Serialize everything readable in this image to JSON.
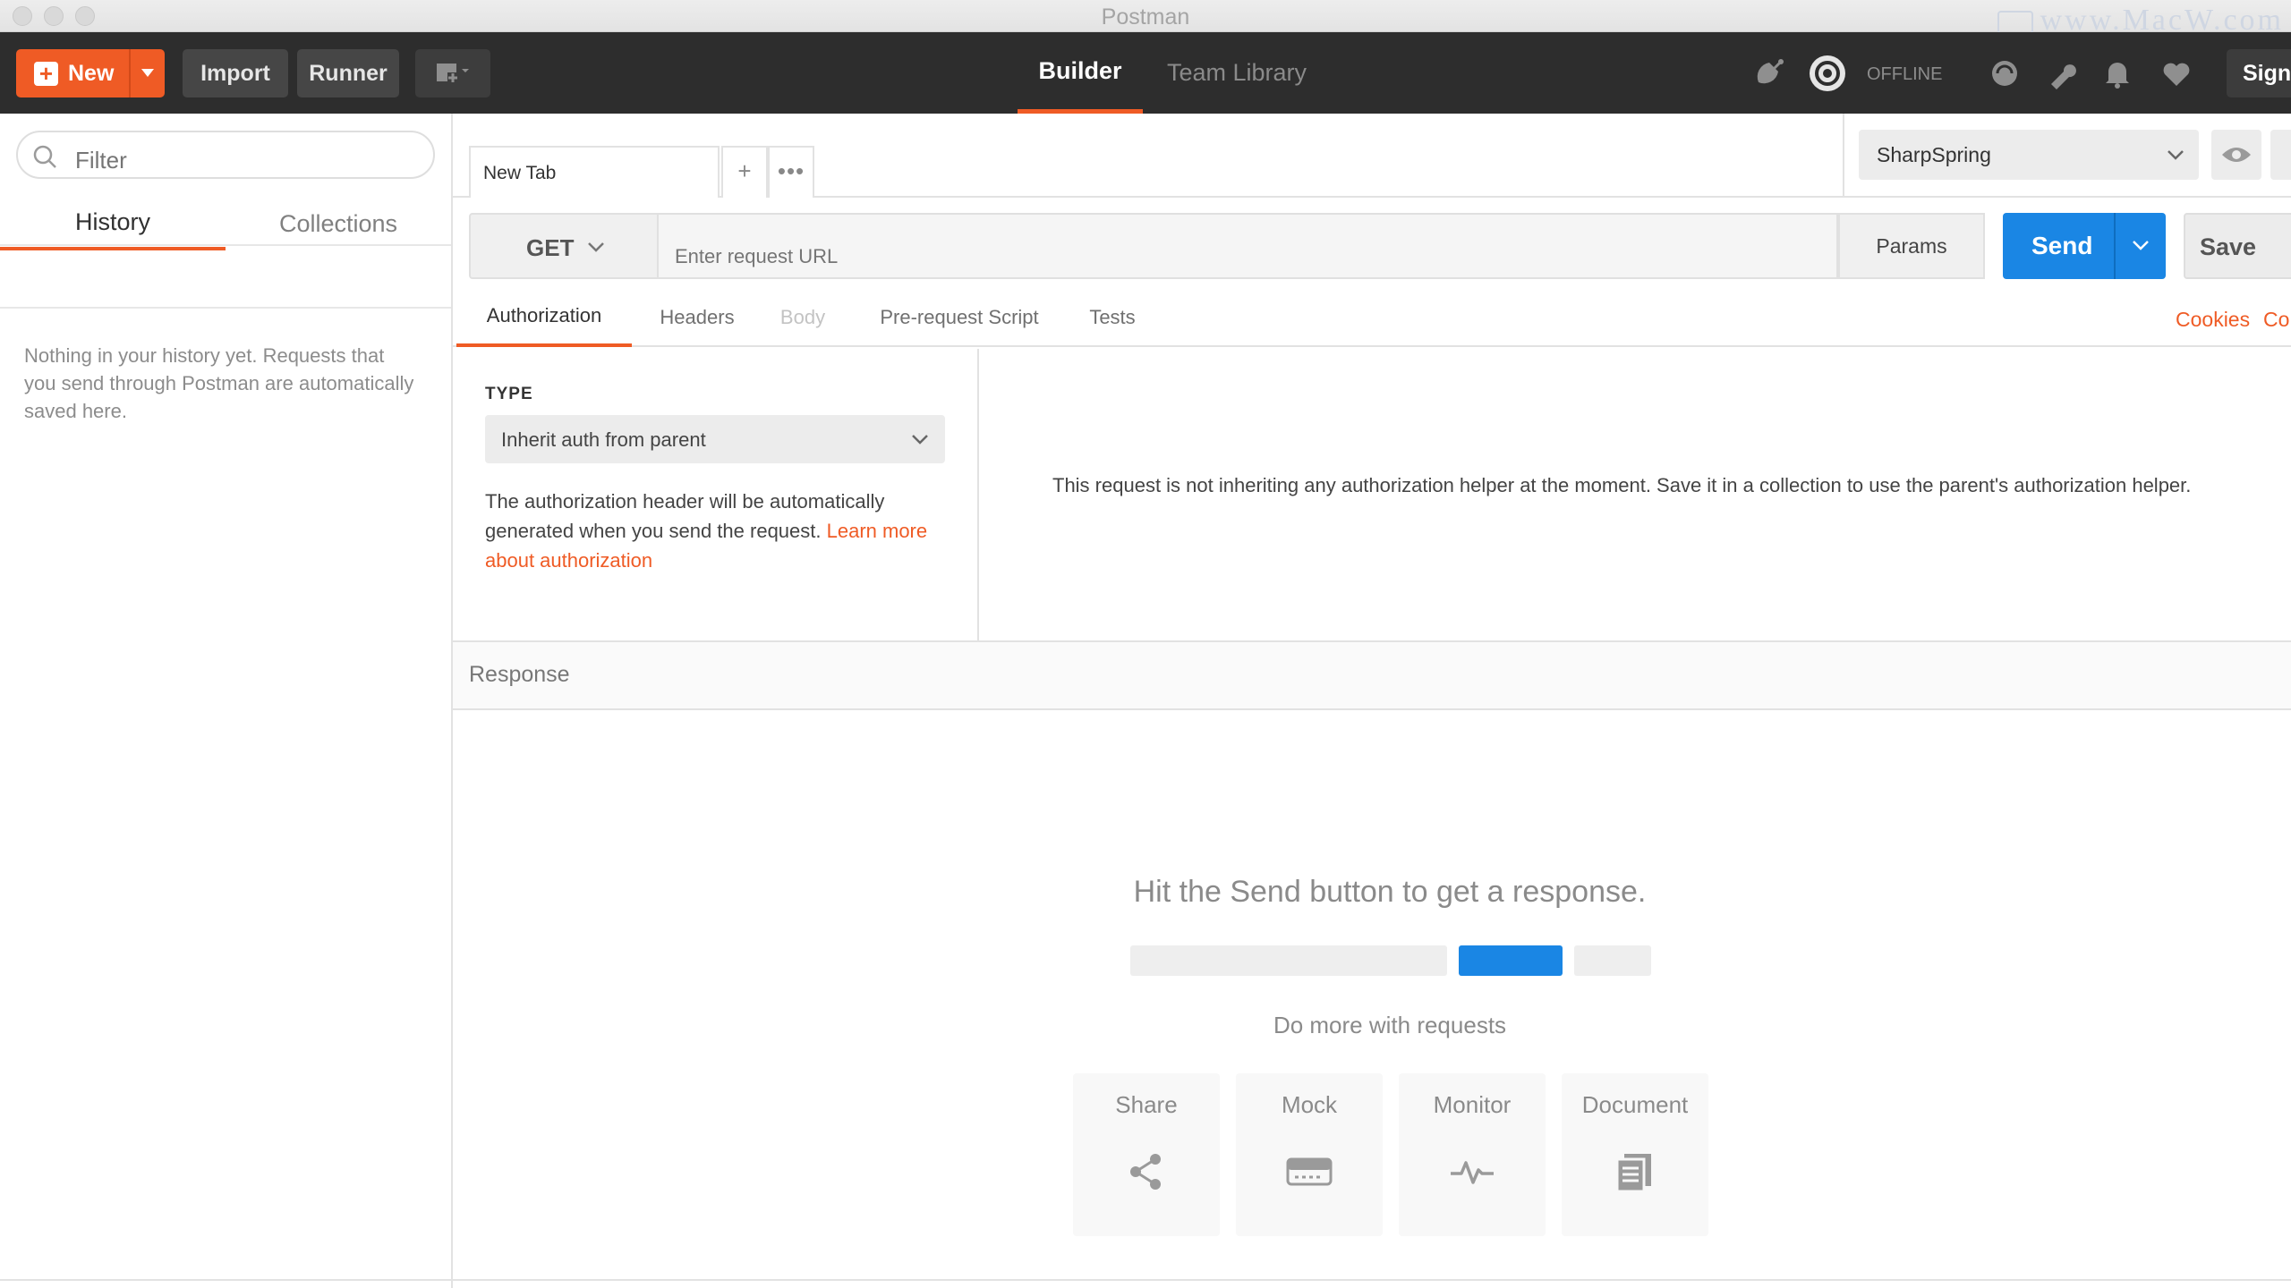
{
  "window": {
    "title": "Postman",
    "watermark": "www.MacW.com"
  },
  "header": {
    "new_label": "New",
    "import_label": "Import",
    "runner_label": "Runner",
    "tabs": [
      {
        "label": "Builder"
      },
      {
        "label": "Team Library"
      }
    ],
    "status_label": "OFFLINE",
    "signin_label": "Sign I"
  },
  "sidebar": {
    "filter_placeholder": "Filter",
    "tabs": [
      {
        "label": "History"
      },
      {
        "label": "Collections"
      }
    ],
    "empty_message": "Nothing in your history yet. Requests that you send through Postman are automatically saved here."
  },
  "request_tabs": {
    "active_tab": "New Tab",
    "add_symbol": "+",
    "more_symbol": "•••"
  },
  "environment": {
    "selected": "SharpSpring"
  },
  "url_bar": {
    "method": "GET",
    "url_value": "",
    "url_placeholder": "Enter request URL",
    "params_label": "Params",
    "send_label": "Send",
    "save_label": "Save"
  },
  "request_section_tabs": [
    {
      "label": "Authorization",
      "state": "active"
    },
    {
      "label": "Headers",
      "state": "normal"
    },
    {
      "label": "Body",
      "state": "disabled"
    },
    {
      "label": "Pre-request Script",
      "state": "normal"
    },
    {
      "label": "Tests",
      "state": "normal"
    }
  ],
  "links": {
    "cookies": "Cookies",
    "code": "Co"
  },
  "auth": {
    "type_label": "TYPE",
    "type_value": "Inherit auth from parent",
    "description": "The authorization header will be automatically generated when you send the request. ",
    "learn_more": "Learn more about authorization",
    "message": "This request is not inheriting any authorization helper at the moment. Save it in a collection to use the parent's authorization helper."
  },
  "response": {
    "label": "Response",
    "hint": "Hit the Send button to get a response.",
    "do_more": "Do more with requests",
    "features": [
      {
        "label": "Share",
        "icon": "share-icon"
      },
      {
        "label": "Mock",
        "icon": "mock-server-icon"
      },
      {
        "label": "Monitor",
        "icon": "monitor-pulse-icon"
      },
      {
        "label": "Document",
        "icon": "document-icon"
      }
    ]
  },
  "colors": {
    "accent": "#ef5b25",
    "primary_blue": "#1a86e4",
    "header_bg": "#2d2d2d"
  }
}
